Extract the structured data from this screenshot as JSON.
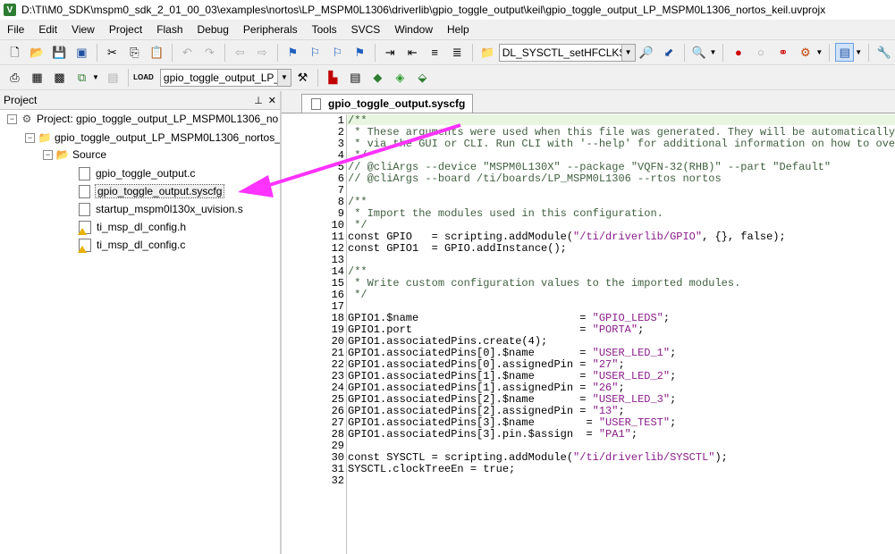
{
  "window": {
    "title": "D:\\TI\\M0_SDK\\mspm0_sdk_2_01_00_03\\examples\\nortos\\LP_MSPM0L1306\\driverlib\\gpio_toggle_output\\keil\\gpio_toggle_output_LP_MSPM0L1306_nortos_keil.uvprojx",
    "app_icon": "V"
  },
  "menu": [
    "File",
    "Edit",
    "View",
    "Project",
    "Flash",
    "Debug",
    "Peripherals",
    "Tools",
    "SVCS",
    "Window",
    "Help"
  ],
  "toolbar1": {
    "function_combo": "DL_SYSCTL_setHFCLKSour"
  },
  "toolbar2": {
    "target_combo": "gpio_toggle_output_LP_"
  },
  "project_panel": {
    "title": "Project",
    "pin_glyph": "⊥",
    "close_glyph": "✕",
    "tree": [
      {
        "label": "Project: gpio_toggle_output_LP_MSPM0L1306_no",
        "toggle": "−"
      },
      {
        "label": "gpio_toggle_output_LP_MSPM0L1306_nortos_",
        "toggle": "−"
      },
      {
        "label": "Source",
        "toggle": "−"
      },
      {
        "label": "gpio_toggle_output.c"
      },
      {
        "label": "gpio_toggle_output.syscfg"
      },
      {
        "label": "startup_mspm0l130x_uvision.s"
      },
      {
        "label": "ti_msp_dl_config.h"
      },
      {
        "label": "ti_msp_dl_config.c"
      }
    ]
  },
  "editor": {
    "tab_label": "gpio_toggle_output.syscfg",
    "line_numbers": [
      "1",
      "2",
      "3",
      "4",
      "5",
      "6",
      "7",
      "8",
      "9",
      "10",
      "11",
      "12",
      "13",
      "14",
      "15",
      "16",
      "17",
      "18",
      "19",
      "20",
      "21",
      "22",
      "23",
      "24",
      "25",
      "26",
      "27",
      "28",
      "29",
      "30",
      "31",
      "32"
    ],
    "code_lines": [
      "/**",
      " * These arguments were used when this file was generated. They will be automatically ap",
      " * via the GUI or CLI. Run CLI with '--help' for additional information on how to overri",
      " */",
      "// @cliArgs --device \"MSPM0L130X\" --package \"VQFN-32(RHB)\" --part \"Default\"",
      "// @cliArgs --board /ti/boards/LP_MSPM0L1306 --rtos nortos",
      "",
      "/**",
      " * Import the modules used in this configuration.",
      " */",
      "const GPIO   = scripting.addModule(\"/ti/driverlib/GPIO\", {}, false);",
      "const GPIO1  = GPIO.addInstance();",
      "",
      "/**",
      " * Write custom configuration values to the imported modules.",
      " */",
      "",
      "GPIO1.$name                         = \"GPIO_LEDS\";",
      "GPIO1.port                          = \"PORTA\";",
      "GPIO1.associatedPins.create(4);",
      "GPIO1.associatedPins[0].$name       = \"USER_LED_1\";",
      "GPIO1.associatedPins[0].assignedPin = \"27\";",
      "GPIO1.associatedPins[1].$name       = \"USER_LED_2\";",
      "GPIO1.associatedPins[1].assignedPin = \"26\";",
      "GPIO1.associatedPins[2].$name       = \"USER_LED_3\";",
      "GPIO1.associatedPins[2].assignedPin = \"13\";",
      "GPIO1.associatedPins[3].$name        = \"USER_TEST\";",
      "GPIO1.associatedPins[3].pin.$assign  = \"PA1\";",
      "",
      "const SYSCTL = scripting.addModule(\"/ti/driverlib/SYSCTL\");",
      "SYSCTL.clockTreeEn = true;",
      ""
    ]
  },
  "colors": {
    "annotation_arrow": "#ff33ff",
    "comment": "#3f5f3f",
    "string": "#8a1c8a",
    "current_line": "#e8f5e1"
  }
}
